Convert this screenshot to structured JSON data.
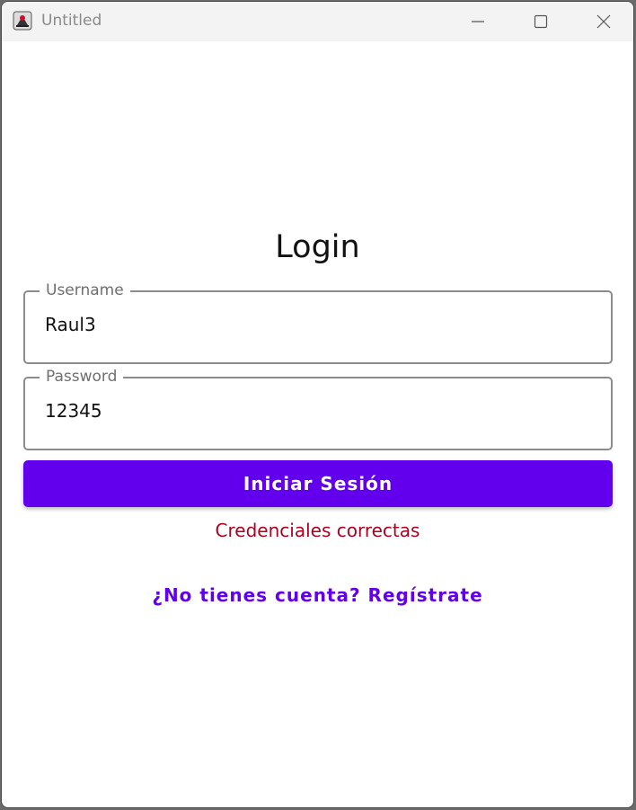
{
  "window": {
    "title": "Untitled",
    "icon": "java-app-icon"
  },
  "titlebar_buttons": {
    "minimize": "minimize-icon",
    "maximize": "maximize-icon",
    "close": "close-icon"
  },
  "login": {
    "heading": "Login",
    "username_label": "Username",
    "username_value": "Raul3",
    "password_label": "Password",
    "password_value": "12345",
    "submit_label": "Iniciar Sesión",
    "status_message": "Credenciales correctas",
    "register_link": "¿No tienes cuenta? Regístrate"
  },
  "colors": {
    "primary": "#6200ee",
    "error": "#b00020",
    "field_border": "#8c8c8c",
    "titlebar": "#f3f3f3"
  }
}
